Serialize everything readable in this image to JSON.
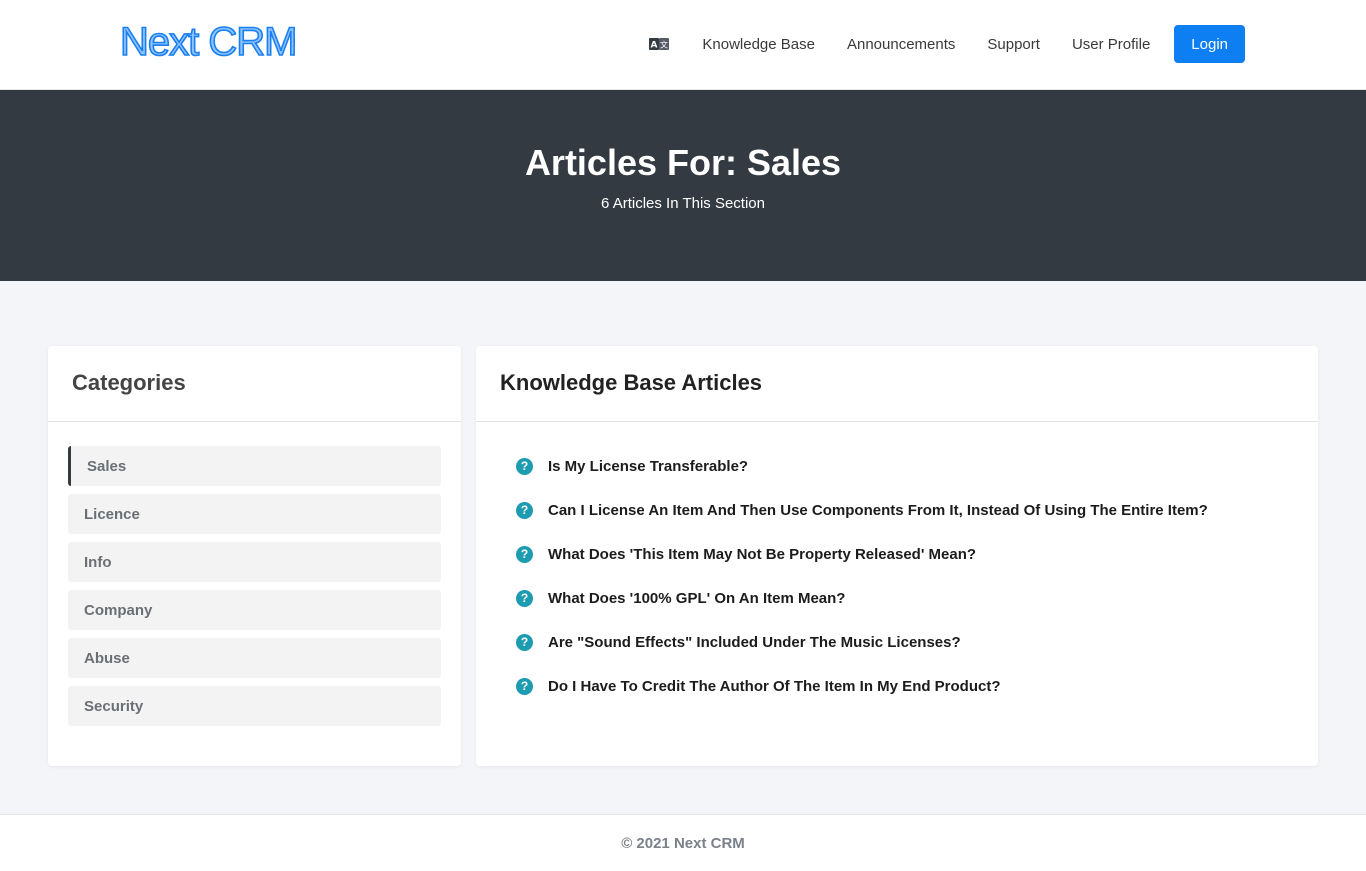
{
  "header": {
    "logo_text": "Next CRM",
    "nav": {
      "language_icon": "translate-icon",
      "links": [
        "Knowledge Base",
        "Announcements",
        "Support",
        "User Profile"
      ],
      "login_label": "Login"
    }
  },
  "hero": {
    "title": "Articles For: Sales",
    "subtitle": "6 Articles In This Section"
  },
  "categories": {
    "title": "Categories",
    "items": [
      "Sales",
      "Licence",
      "Info",
      "Company",
      "Abuse",
      "Security"
    ],
    "active": "Sales"
  },
  "articles": {
    "title": "Knowledge Base Articles",
    "icon": "question-circle-icon",
    "items": [
      "Is My License Transferable?",
      "Can I License An Item And Then Use Components From It, Instead Of Using The Entire Item?",
      "What Does 'This Item May Not Be Property Released' Mean?",
      "What Does '100% GPL' On An Item Mean?",
      "Are \"Sound Effects\" Included Under The Music Licenses?",
      "Do I Have To Credit The Author Of The Item In My End Product?"
    ]
  },
  "footer": {
    "copyright": "© 2021 Next CRM"
  },
  "colors": {
    "brand": "#0d7ff2",
    "hero_bg": "#343a42",
    "page_bg": "#f4f5f8",
    "question_icon": "#1d9bb0"
  }
}
